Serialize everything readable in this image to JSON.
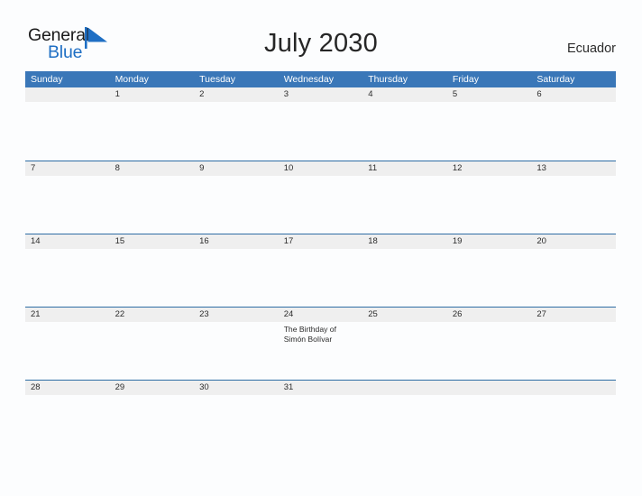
{
  "brand": {
    "name_part1": "General",
    "name_part2": "Blue",
    "flag_icon": "blue-triangle-flag-icon",
    "accent_color": "#1f6fc4"
  },
  "header": {
    "title": "July 2030",
    "country": "Ecuador"
  },
  "theme": {
    "header_blue": "#3a77b8",
    "row_divider_blue": "#2e6da4",
    "daynum_band_gray": "#efefef",
    "page_background": "#fcfdfe",
    "text_color": "#2b2b2b"
  },
  "calendar": {
    "weekdays": [
      "Sunday",
      "Monday",
      "Tuesday",
      "Wednesday",
      "Thursday",
      "Friday",
      "Saturday"
    ],
    "weeks": [
      {
        "days": [
          {
            "number": "",
            "event": ""
          },
          {
            "number": "1",
            "event": ""
          },
          {
            "number": "2",
            "event": ""
          },
          {
            "number": "3",
            "event": ""
          },
          {
            "number": "4",
            "event": ""
          },
          {
            "number": "5",
            "event": ""
          },
          {
            "number": "6",
            "event": ""
          }
        ]
      },
      {
        "days": [
          {
            "number": "7",
            "event": ""
          },
          {
            "number": "8",
            "event": ""
          },
          {
            "number": "9",
            "event": ""
          },
          {
            "number": "10",
            "event": ""
          },
          {
            "number": "11",
            "event": ""
          },
          {
            "number": "12",
            "event": ""
          },
          {
            "number": "13",
            "event": ""
          }
        ]
      },
      {
        "days": [
          {
            "number": "14",
            "event": ""
          },
          {
            "number": "15",
            "event": ""
          },
          {
            "number": "16",
            "event": ""
          },
          {
            "number": "17",
            "event": ""
          },
          {
            "number": "18",
            "event": ""
          },
          {
            "number": "19",
            "event": ""
          },
          {
            "number": "20",
            "event": ""
          }
        ]
      },
      {
        "days": [
          {
            "number": "21",
            "event": ""
          },
          {
            "number": "22",
            "event": ""
          },
          {
            "number": "23",
            "event": ""
          },
          {
            "number": "24",
            "event": "The Birthday of Simón Bolívar"
          },
          {
            "number": "25",
            "event": ""
          },
          {
            "number": "26",
            "event": ""
          },
          {
            "number": "27",
            "event": ""
          }
        ]
      },
      {
        "days": [
          {
            "number": "28",
            "event": ""
          },
          {
            "number": "29",
            "event": ""
          },
          {
            "number": "30",
            "event": ""
          },
          {
            "number": "31",
            "event": ""
          },
          {
            "number": "",
            "event": ""
          },
          {
            "number": "",
            "event": ""
          },
          {
            "number": "",
            "event": ""
          }
        ]
      }
    ]
  }
}
